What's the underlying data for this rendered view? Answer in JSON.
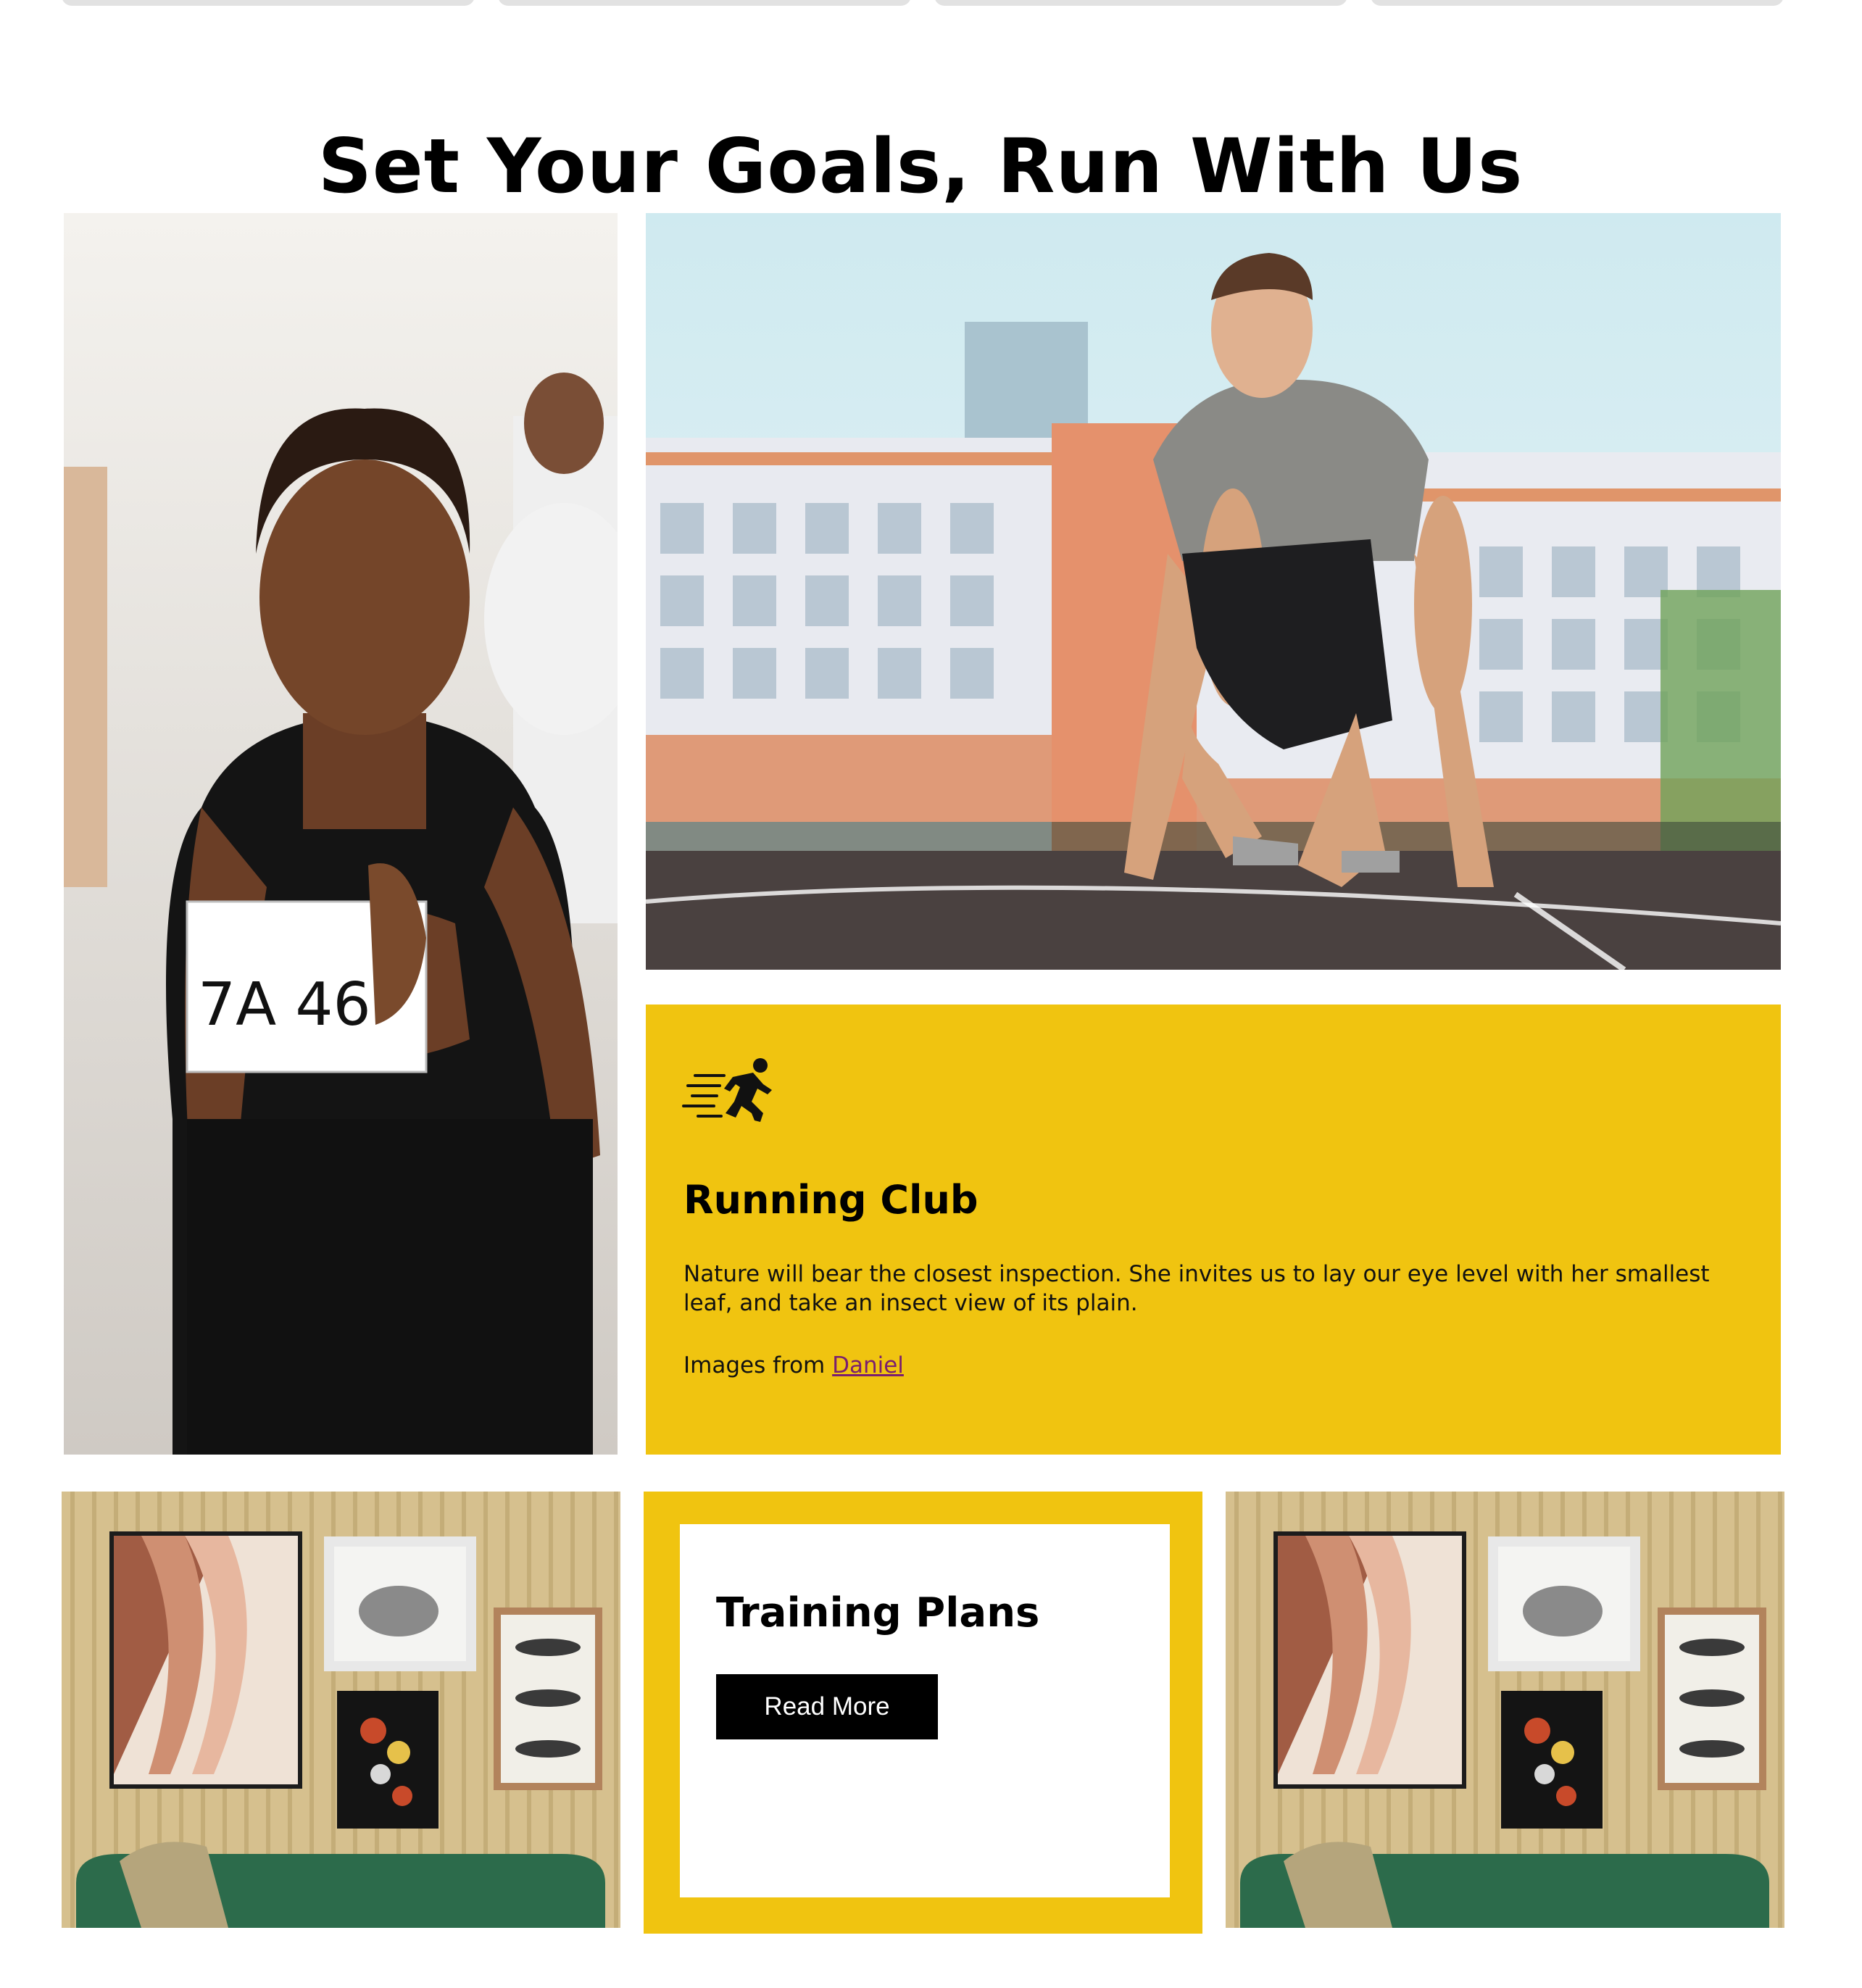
{
  "section": {
    "title": "Set Your Goals, Run With Us"
  },
  "running_club": {
    "icon": "running-person-icon",
    "title": "Running Club",
    "text": "Nature will bear the closest inspection. She invites us to lay our eye level with her smallest leaf, and take an insect view of its plain.",
    "credit_prefix": "Images from ",
    "credit_link": "Daniel"
  },
  "training_plans": {
    "title": "Training Plans",
    "button_label": "Read More"
  },
  "colors": {
    "accent_yellow": "#f0c410",
    "button_black": "#000000",
    "link": "#7a1f6f"
  }
}
